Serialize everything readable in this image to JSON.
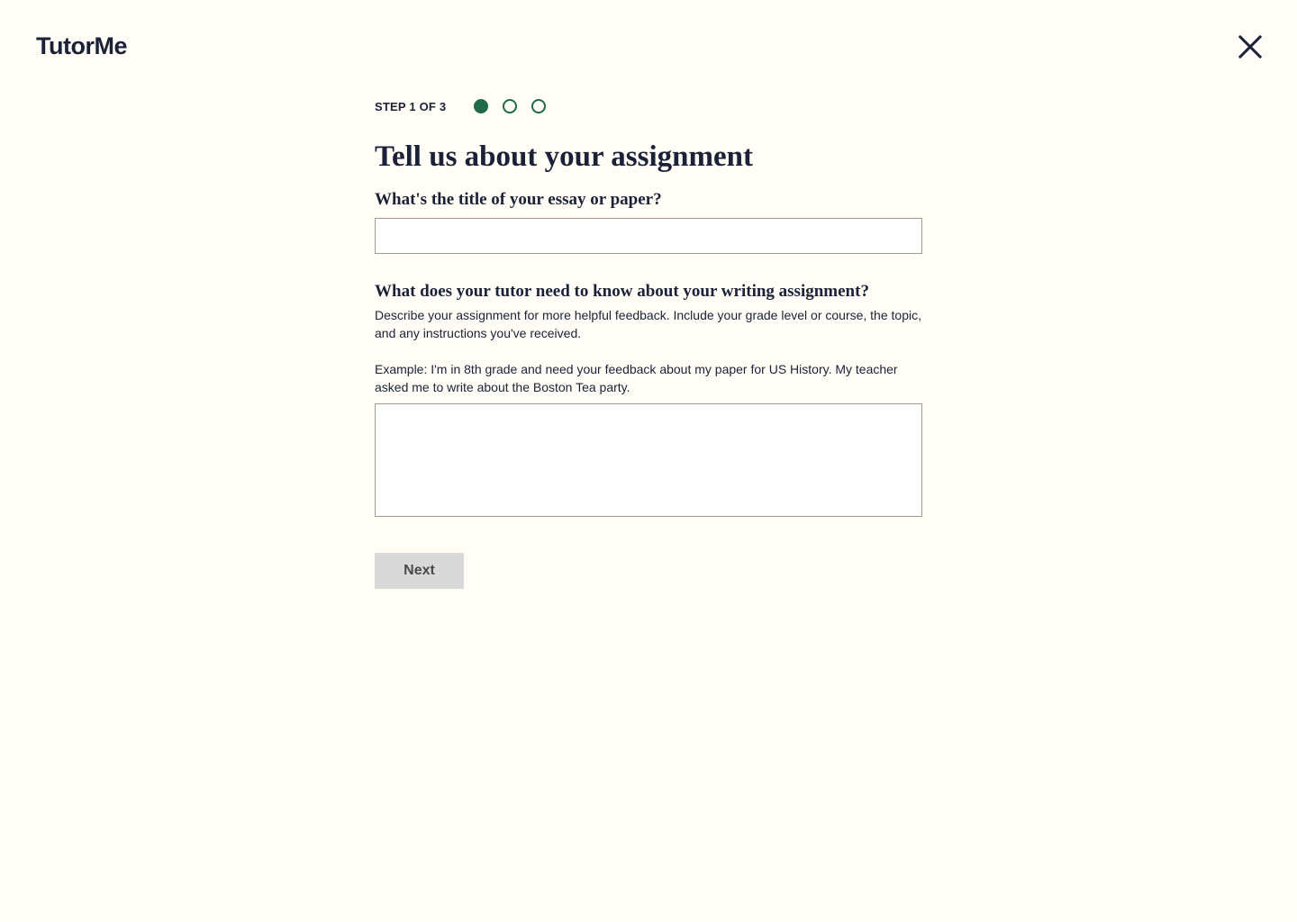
{
  "brand": {
    "logo_text": "TutorMe"
  },
  "header": {
    "close_icon": "close-icon"
  },
  "stepper": {
    "label": "STEP 1 OF 3",
    "current": 1,
    "total": 3
  },
  "page": {
    "title": "Tell us about your assignment"
  },
  "form": {
    "title_question": "What's the title of your essay or paper?",
    "title_value": "",
    "details_question": "What does your tutor need to know about your writing assignment?",
    "details_help": "Describe your assignment for more helpful feedback. Include your grade level or course, the topic, and any instructions you've received.",
    "details_example": "Example: I'm in 8th grade and need your feedback about my paper for US History. My teacher asked me to write about the Boston Tea party.",
    "details_value": ""
  },
  "actions": {
    "next_label": "Next"
  },
  "colors": {
    "background": "#fffdf5",
    "text": "#1b2238",
    "accent_green": "#1e6a4a",
    "button_disabled_bg": "#d9d9d9",
    "input_border": "#a89a86"
  }
}
